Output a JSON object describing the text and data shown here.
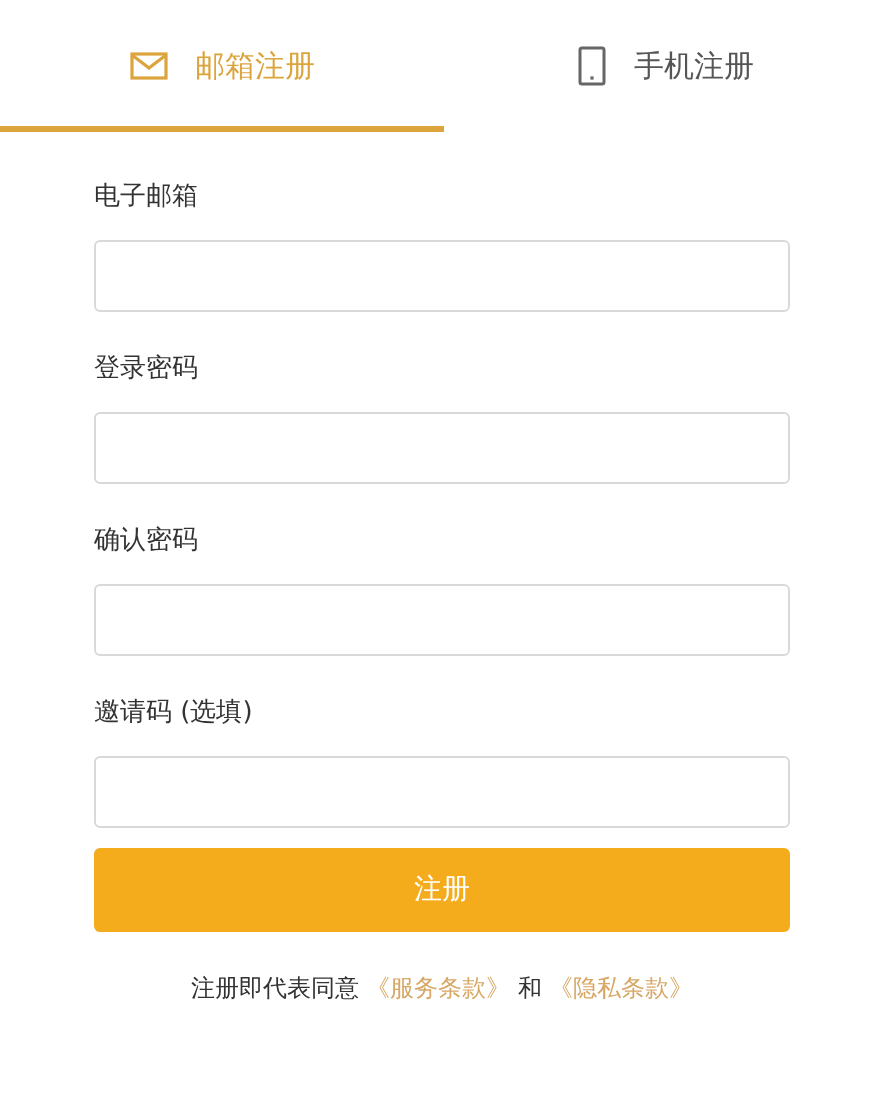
{
  "tabs": [
    {
      "label": "邮箱注册",
      "kind": "mail",
      "selected": true
    },
    {
      "label": "手机注册",
      "kind": "phone",
      "selected": false
    }
  ],
  "fields": [
    {
      "label": "电子邮箱"
    },
    {
      "label": "登录密码"
    },
    {
      "label": "确认密码"
    },
    {
      "label": "邀请码 (选填)"
    }
  ],
  "submit_button": "注册",
  "terms": {
    "text": "注册即代表同意",
    "links": [
      "《服务条款》",
      "《隐私条款》"
    ],
    "joiner": "和"
  }
}
